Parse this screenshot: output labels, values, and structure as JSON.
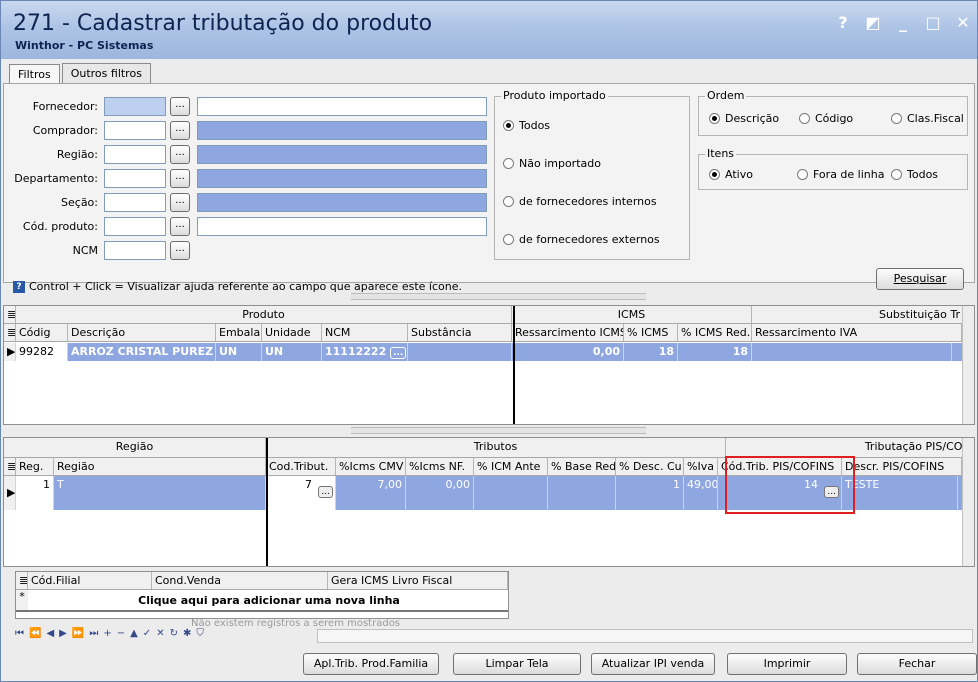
{
  "window": {
    "title": "271 - Cadastrar tributação do produto",
    "subtitle": "Winthor - PC Sistemas",
    "controls": [
      "?",
      "◩",
      "_",
      "□",
      "✕"
    ]
  },
  "tabs": [
    {
      "label": "Filtros"
    },
    {
      "label": "Outros filtros"
    }
  ],
  "filters": [
    {
      "label": "Fornecedor:",
      "value": "",
      "btn": "..."
    },
    {
      "label": "Comprador:",
      "value": "",
      "btn": "..."
    },
    {
      "label": "Região:",
      "value": "",
      "btn": "..."
    },
    {
      "label": "Departamento:",
      "value": "",
      "btn": "..."
    },
    {
      "label": "Seção:",
      "value": "",
      "btn": "..."
    },
    {
      "label": "Cód. produto:",
      "value": "",
      "btn": "..."
    },
    {
      "label": "NCM",
      "value": "",
      "btn": "..."
    }
  ],
  "produto_importado": {
    "legend": "Produto importado",
    "options": [
      {
        "label": "Todos",
        "checked": true
      },
      {
        "label": "Não importado",
        "checked": false
      },
      {
        "label": "de fornecedores internos",
        "checked": false
      },
      {
        "label": "de fornecedores externos",
        "checked": false
      }
    ]
  },
  "ordem": {
    "legend": "Ordem",
    "options": [
      {
        "label": "Descrição",
        "checked": true
      },
      {
        "label": "Código",
        "checked": false
      },
      {
        "label": "Clas.Fiscal",
        "checked": false
      }
    ]
  },
  "itens": {
    "legend": "Itens",
    "options": [
      {
        "label": "Ativo",
        "checked": true
      },
      {
        "label": "Fora de linha",
        "checked": false
      },
      {
        "label": "Todos",
        "checked": false
      }
    ]
  },
  "pesquisar_label": "Pesquisar",
  "hint": "Control + Click = Visualizar ajuda referente ao campo que aparece este ícone.",
  "grid1": {
    "bands": [
      "Produto",
      "ICMS",
      "Substituição Tr"
    ],
    "headers": [
      "Códig",
      "Descrição",
      "Embala",
      "Unidade",
      "NCM",
      "Substância",
      "Ressarcimento ICMS",
      "% ICMS",
      "% ICMS Red.",
      "Ressarcimento IVA"
    ],
    "row": {
      "codigo": "99282",
      "descricao": "ARROZ CRISTAL PUREZ",
      "embalagem": "UN",
      "unidade": "UN",
      "ncm": "11112222",
      "substancia": "",
      "ressarcimento": "0,00",
      "icms": "18",
      "icms_red": "18",
      "iva": ""
    }
  },
  "grid2": {
    "bands": [
      "Região",
      "Tributos",
      "Tributação PIS/COFI"
    ],
    "headers": [
      "Reg.",
      "Região",
      "Cod.Tribut.",
      "%Icms CMV",
      "%Icms NF.",
      "% ICM Ante",
      "% Base Red",
      "% Desc. Cu",
      "%Iva",
      "Cód.Trib. PIS/COFINS",
      "Descr. PIS/COFINS"
    ],
    "row": {
      "reg": "1",
      "regiao": "T",
      "cod_tribut": "7",
      "icms_cmv": "7,00",
      "icms_nf": "0,00",
      "icm_ante": "",
      "base_red": "",
      "desc_cu": "1",
      "iva": "49,00",
      "cod_pis": "14",
      "descr_pis": "TESTE"
    }
  },
  "grid3": {
    "headers": [
      "Cód.Filial",
      "Cond.Venda",
      "Gera ICMS Livro Fiscal"
    ],
    "add_row": "Clique aqui para adicionar uma nova linha",
    "empty": "Não existem registros a serem mostrados"
  },
  "buttons": {
    "apl": "Apl.Trib. Prod.Familia",
    "limpar": "Limpar Tela",
    "atualizar": "Atualizar IPI venda",
    "imprimir": "Imprimir",
    "fechar": "Fechar"
  },
  "colors": {
    "selection": "#8fa7e0",
    "highlight_box": "#e02020"
  }
}
